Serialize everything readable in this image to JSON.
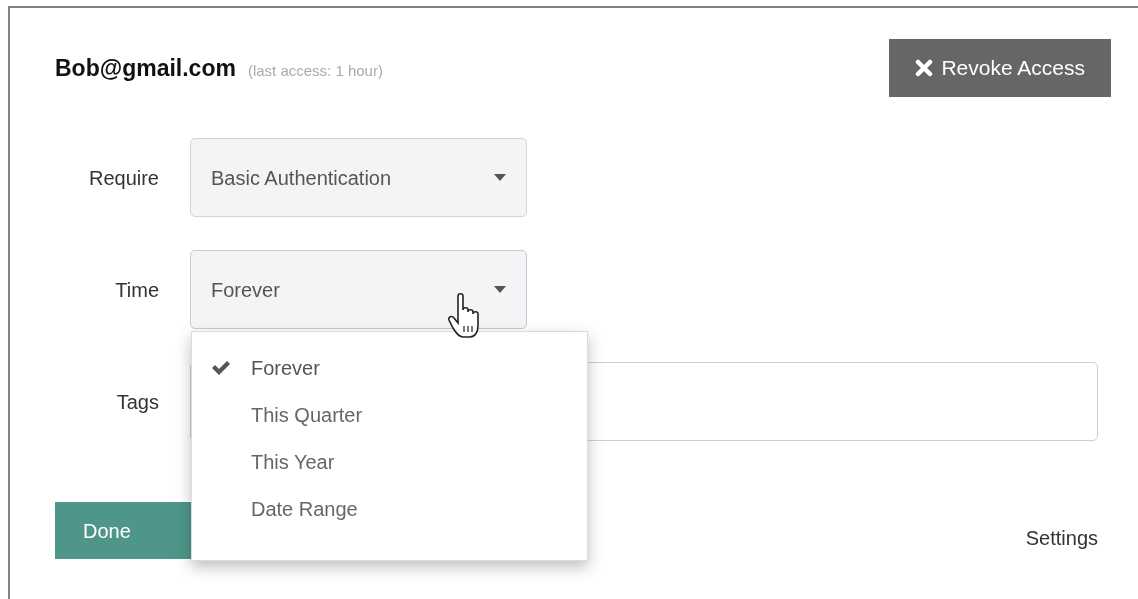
{
  "account": {
    "email": "Bob@gmail.com",
    "last_access": "(last access: 1 hour)"
  },
  "revoke_button": {
    "label": "Revoke Access"
  },
  "fields": [
    {
      "kind": "select",
      "label": "Require",
      "value": "Basic Authentication",
      "expanded": false
    },
    {
      "kind": "select",
      "label": "Time",
      "value": "Forever",
      "expanded": true
    },
    {
      "kind": "text",
      "label": "Tags"
    }
  ],
  "time_menu": [
    {
      "label": "Forever",
      "selected": true
    },
    {
      "label": "This Quarter",
      "selected": false
    },
    {
      "label": "This Year",
      "selected": false
    },
    {
      "label": "Date Range",
      "selected": false
    }
  ],
  "done_button": {
    "label": "Done"
  },
  "settings_link": {
    "label": "Settings"
  }
}
